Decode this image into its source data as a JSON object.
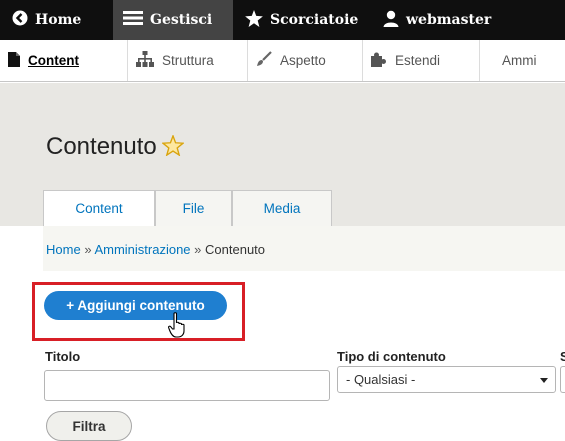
{
  "toolbar": {
    "home_label": "Home",
    "manage_label": "Gestisci",
    "shortcuts_label": "Scorciatoie",
    "user_label": "webmaster"
  },
  "tray": {
    "items": [
      {
        "label": "Content",
        "icon": "content-file-icon"
      },
      {
        "label": "Struttura",
        "icon": "structure-icon"
      },
      {
        "label": "Aspetto",
        "icon": "paintbrush-icon"
      },
      {
        "label": "Estendi",
        "icon": "puzzle-icon"
      },
      {
        "label": "Ammi",
        "icon": ""
      }
    ]
  },
  "header": {
    "title": "Contenuto",
    "tabs": [
      {
        "label": "Content"
      },
      {
        "label": "File"
      },
      {
        "label": "Media"
      }
    ]
  },
  "breadcrumb": {
    "items": [
      "Home",
      "Amministrazione",
      "Contenuto"
    ],
    "separator": "»"
  },
  "actions": {
    "add_label": "+ Aggiungi contenuto"
  },
  "filters": {
    "title_label": "Titolo",
    "title_value": "",
    "type_label": "Tipo di contenuto",
    "type_value": "- Qualsiasi -",
    "extra_label": "S",
    "filter_button": "Filtra"
  },
  "colors": {
    "toolbar_bg": "#0f0f0f",
    "accent": "#1f7fd0",
    "link": "#0074bd",
    "highlight": "#d81f26",
    "star": "#e3b21a"
  }
}
